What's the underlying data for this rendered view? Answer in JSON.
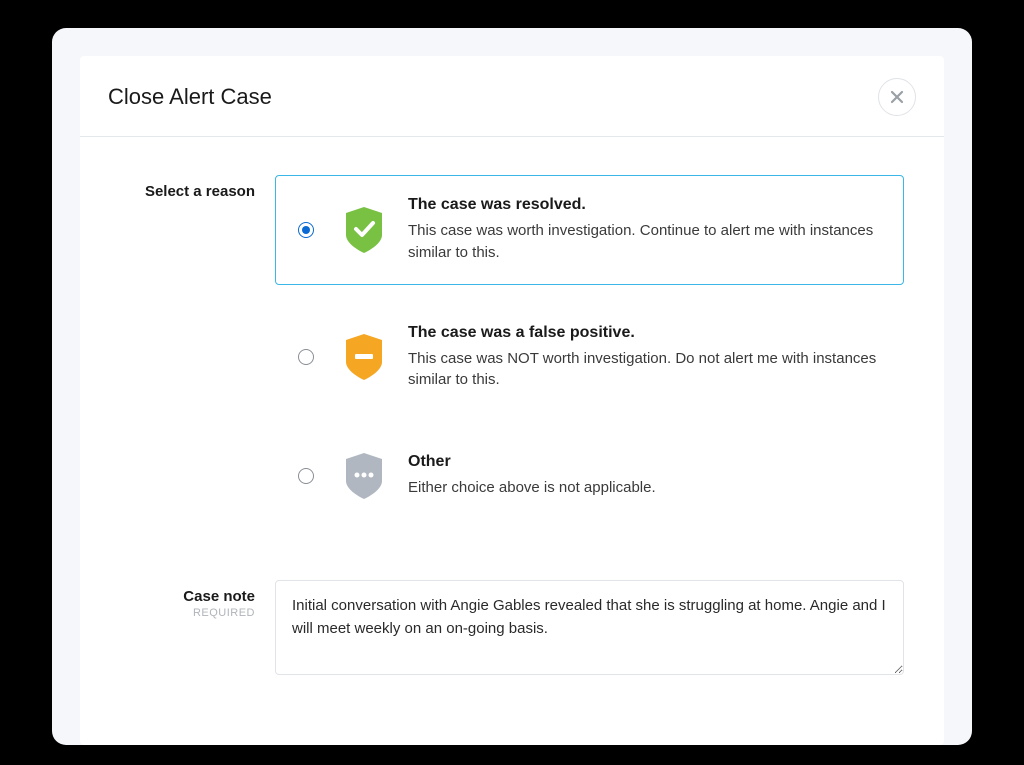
{
  "dialog": {
    "title": "Close Alert Case"
  },
  "reason": {
    "label": "Select a reason",
    "options": [
      {
        "title": "The case was resolved.",
        "desc": "This case was worth investigation. Continue to alert me with instances similar to this.",
        "selected": true
      },
      {
        "title": "The case was a false positive.",
        "desc": "This case was NOT worth investigation. Do not alert me with instances similar to this.",
        "selected": false
      },
      {
        "title": "Other",
        "desc": "Either choice above is not applicable.",
        "selected": false
      }
    ]
  },
  "note": {
    "label": "Case note",
    "sublabel": "REQUIRED",
    "value": "Initial conversation with Angie Gables revealed that she is struggling at home. Angie and I will meet weekly on an on-going basis."
  },
  "colors": {
    "shield_resolved": "#79c143",
    "shield_false": "#f5a623",
    "shield_other": "#b0b7c0",
    "accent": "#3ab7e6",
    "radio": "#0b69d4"
  }
}
